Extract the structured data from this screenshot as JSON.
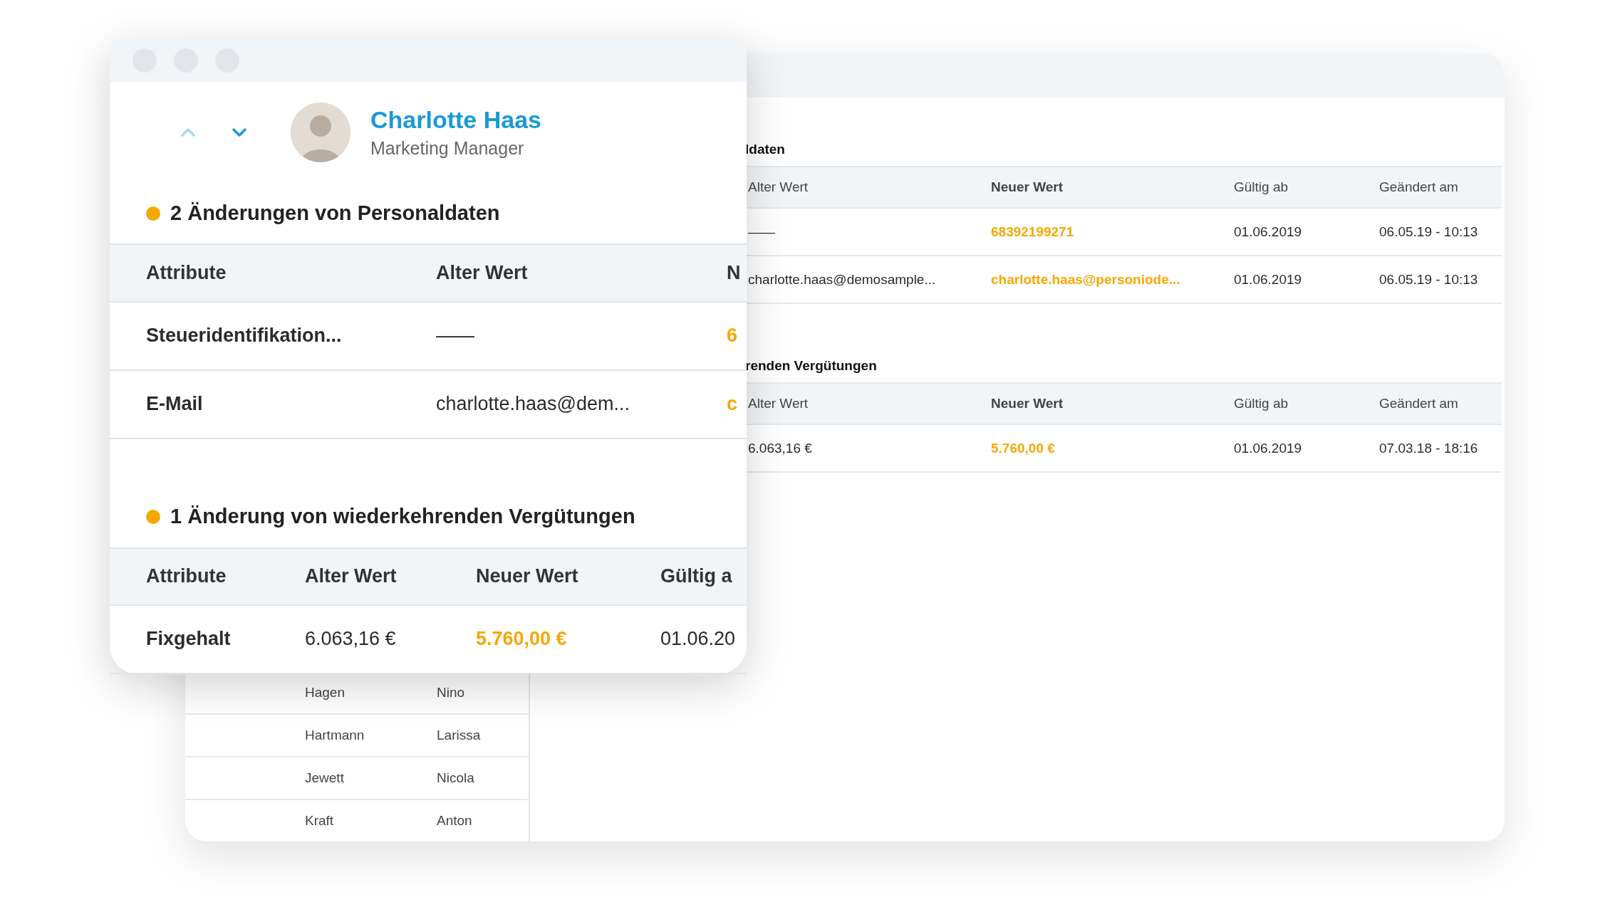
{
  "back_window": {
    "sections": [
      {
        "heading": "ldaten",
        "columns": [
          {
            "label": "Alter Wert",
            "kind": "old"
          },
          {
            "label": "Neuer Wert",
            "kind": "new"
          },
          {
            "label": "Gültig ab",
            "kind": "plain"
          },
          {
            "label": "Geändert am",
            "kind": "plain"
          }
        ],
        "rows": [
          [
            "——",
            "68392199271",
            "01.06.2019",
            "06.05.19 - 10:13"
          ],
          [
            "charlotte.haas@demosample...",
            "charlotte.haas@personiode...",
            "01.06.2019",
            "06.05.19 - 10:13"
          ]
        ]
      },
      {
        "heading": "renden Vergütungen",
        "columns": [
          {
            "label": "Alter Wert",
            "kind": "old"
          },
          {
            "label": "Neuer Wert",
            "kind": "new"
          },
          {
            "label": "Gültig ab",
            "kind": "plain"
          },
          {
            "label": "Geändert am",
            "kind": "plain"
          }
        ],
        "rows": [
          [
            "6.063,16 €",
            "5.760,00 €",
            "01.06.2019",
            "07.03.18 - 18:16"
          ]
        ]
      }
    ],
    "employees": [
      {
        "last_name": "Hagen",
        "first_name": "Nino"
      },
      {
        "last_name": "Hartmann",
        "first_name": "Larissa"
      },
      {
        "last_name": "Jewett",
        "first_name": "Nicola"
      },
      {
        "last_name": "Kraft",
        "first_name": "Anton"
      }
    ]
  },
  "front_card": {
    "navigation": {
      "previous": {
        "disabled": true
      },
      "next": {
        "disabled": false
      }
    },
    "employee": {
      "name": "Charlotte Haas",
      "role": "Marketing Manager"
    },
    "sections": [
      {
        "heading": "2 Änderungen von Personaldaten",
        "columns": [
          {
            "label": "Attribute",
            "kind": "attr"
          },
          {
            "label": "Alter Wert",
            "kind": "old"
          },
          {
            "label": "N",
            "kind": "new"
          }
        ],
        "rows": [
          [
            "Steueridentifikation...",
            "——",
            "6"
          ],
          [
            "E-Mail",
            "charlotte.haas@dem...",
            "c"
          ]
        ]
      },
      {
        "heading": "1 Änderung von wiederkehrenden Vergütungen",
        "columns": [
          {
            "label": "Attribute",
            "kind": "attr"
          },
          {
            "label": "Alter Wert",
            "kind": "old"
          },
          {
            "label": "Neuer Wert",
            "kind": "new"
          },
          {
            "label": "Gültig a",
            "kind": "plain"
          }
        ],
        "rows": [
          [
            "Fixgehalt",
            "6.063,16 €",
            "5.760,00 €",
            "01.06.20"
          ]
        ]
      }
    ]
  }
}
